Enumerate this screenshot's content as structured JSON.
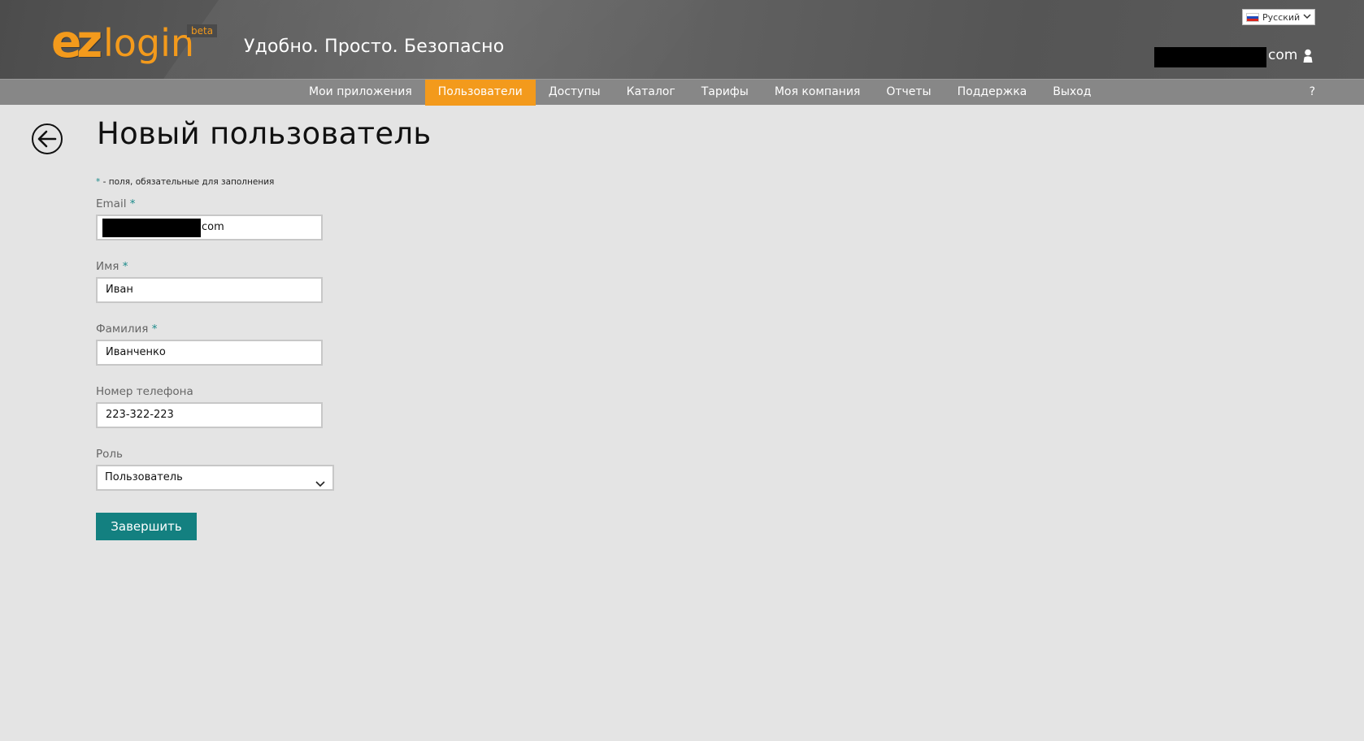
{
  "header": {
    "logo": {
      "ez": "ez",
      "login": "login",
      "beta": "beta"
    },
    "tagline": "Удобно. Просто. Безопасно",
    "language": {
      "selected": "Русский",
      "flag": "ru-flag"
    },
    "user": {
      "email_suffix": "com",
      "icon": "user-icon"
    }
  },
  "nav": {
    "items": [
      {
        "label": "Мои приложения",
        "active": false
      },
      {
        "label": "Пользователи",
        "active": true
      },
      {
        "label": "Доступы",
        "active": false
      },
      {
        "label": "Каталог",
        "active": false
      },
      {
        "label": "Тарифы",
        "active": false
      },
      {
        "label": "Моя компания",
        "active": false
      },
      {
        "label": "Отчеты",
        "active": false
      },
      {
        "label": "Поддержка",
        "active": false
      },
      {
        "label": "Выход",
        "active": false
      }
    ],
    "help": "?"
  },
  "page": {
    "title": "Новый пользователь",
    "required_note_star": "*",
    "required_note": " - поля, обязательные для заполнения"
  },
  "form": {
    "email": {
      "label": "Email",
      "star": "*",
      "value_suffix": "com"
    },
    "first_name": {
      "label": "Имя",
      "star": "*",
      "value": "Иван"
    },
    "last_name": {
      "label": "Фамилия",
      "star": "*",
      "value": "Иванченко"
    },
    "phone": {
      "label": "Номер телефона",
      "value": "223-322-223"
    },
    "role": {
      "label": "Роль",
      "value": "Пользователь"
    },
    "submit_label": "Завершить"
  },
  "colors": {
    "accent_orange": "#f39a1c",
    "accent_teal": "#138080",
    "nav_gray": "#878787",
    "background": "#e4e4e4"
  }
}
